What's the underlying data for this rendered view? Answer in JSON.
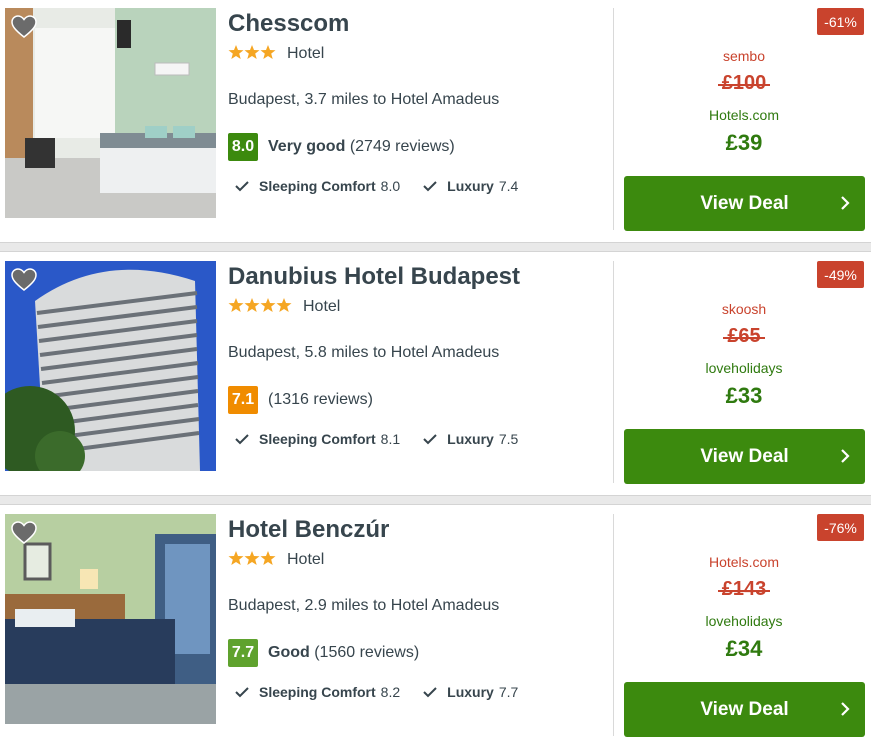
{
  "hotels": [
    {
      "name": "Chesscom",
      "stars": 3,
      "type": "Hotel",
      "location": "Budapest, 3.7 miles to Hotel Amadeus",
      "rating": "8.0",
      "rating_label": "Very good",
      "rating_color": "#3c8a0e",
      "reviews": "(2749 reviews)",
      "sub1_label": "Sleeping Comfort",
      "sub1_value": "8.0",
      "sub2_label": "Luxury",
      "sub2_value": "7.4",
      "discount": "-61%",
      "provider_old": "sembo",
      "price_old": "£100",
      "provider_new": "Hotels.com",
      "price_new": "£39",
      "deal_label": "View Deal"
    },
    {
      "name": "Danubius Hotel Budapest",
      "stars": 4,
      "type": "Hotel",
      "location": "Budapest, 5.8 miles to Hotel Amadeus",
      "rating": "7.1",
      "rating_label": "",
      "rating_color": "#f08c00",
      "reviews": "(1316 reviews)",
      "sub1_label": "Sleeping Comfort",
      "sub1_value": "8.1",
      "sub2_label": "Luxury",
      "sub2_value": "7.5",
      "discount": "-49%",
      "provider_old": "skoosh",
      "price_old": "£65",
      "provider_new": "loveholidays",
      "price_new": "£33",
      "deal_label": "View Deal"
    },
    {
      "name": "Hotel Benczúr",
      "stars": 3,
      "type": "Hotel",
      "location": "Budapest, 2.9 miles to Hotel Amadeus",
      "rating": "7.7",
      "rating_label": "Good",
      "rating_color": "#5fa22e",
      "reviews": "(1560 reviews)",
      "sub1_label": "Sleeping Comfort",
      "sub1_value": "8.2",
      "sub2_label": "Luxury",
      "sub2_value": "7.7",
      "discount": "-76%",
      "provider_old": "Hotels.com",
      "price_old": "£143",
      "provider_new": "loveholidays",
      "price_new": "£34",
      "deal_label": "View Deal"
    }
  ],
  "icons": {
    "favorite": "heart-icon",
    "star": "star-icon",
    "check": "check-icon",
    "chevron": "chevron-right-icon"
  },
  "colors": {
    "deal_button": "#3c8a0e",
    "discount_badge": "#c9432d",
    "old_price": "#c9432d",
    "new_price": "#2f7a0f",
    "star": "#f5a623"
  }
}
